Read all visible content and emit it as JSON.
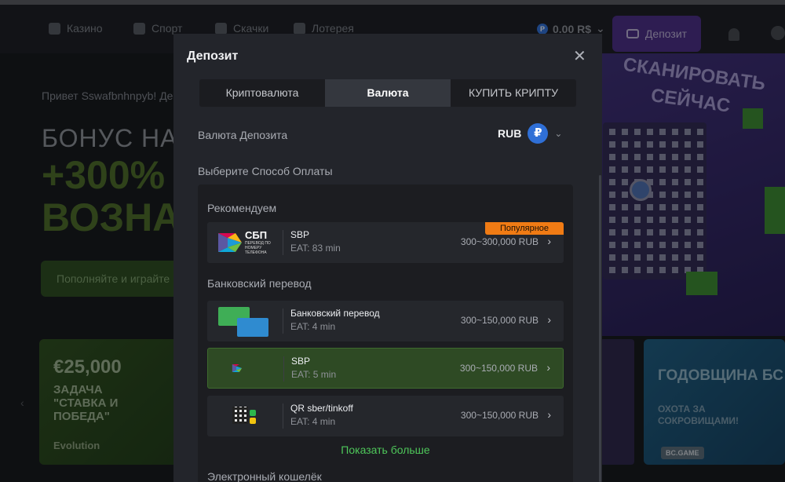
{
  "header": {
    "nav": [
      {
        "label": "Казино",
        "icon": "casino-icon"
      },
      {
        "label": "Спорт",
        "icon": "sport-icon"
      },
      {
        "label": "Скачки",
        "icon": "horse-icon"
      },
      {
        "label": "Лотерея",
        "icon": "lottery-icon"
      }
    ],
    "balance": "0.00 R$",
    "balance_icon": "P",
    "deposit_button": "Депозит"
  },
  "hero": {
    "greeting": "Привет Sswafbnhnpyb! Де",
    "bonus": "БОНУС НА",
    "line1": "+300%",
    "line2": "ВОЗНА",
    "button": "Пополняйте и играйте"
  },
  "promo": {
    "title": "СКАНИРОВАТЬ СЕЙЧАС"
  },
  "cards": {
    "left": {
      "amount": "€25,000",
      "task": "ЗАДАЧА \"СТАВКА И ПОБЕДА\"",
      "provider": "Evolution"
    },
    "right": {
      "title": "ГОДОВЩИНА БС",
      "subtitle": "ОХОТА ЗА СОКРОВИЩАМИ!",
      "brand": "BC.GAME"
    }
  },
  "modal": {
    "title": "Депозит",
    "close": "✕",
    "tabs": [
      {
        "label": "Криптовалюта",
        "active": false
      },
      {
        "label": "Валюта",
        "active": true
      },
      {
        "label": "КУПИТЬ КРИПТУ",
        "active": false
      }
    ],
    "currency_label": "Валюта Депозита",
    "currency_code": "RUB",
    "currency_symbol": "₽",
    "payment_label": "Выберите Способ Оплаты",
    "sections": {
      "recommended": "Рекомендуем",
      "bank": "Банковский перевод",
      "ewallet": "Электронный кошелёк"
    },
    "sbp_logo": {
      "name": "СБП",
      "sub": "ПЕРЕВОД ПО НОМЕРУ ТЕЛЕФОНА"
    },
    "methods": [
      {
        "name": "SBP",
        "eat": "EAT: 83 min",
        "range": "300~300,000 RUB",
        "badge": "Популярное"
      },
      {
        "name": "Банковский перевод",
        "eat": "EAT: 4 min",
        "range": "300~150,000 RUB"
      },
      {
        "name": "SBP",
        "eat": "EAT: 5 min",
        "range": "300~150,000 RUB"
      },
      {
        "name": "QR sber/tinkoff",
        "eat": "EAT: 4 min",
        "range": "300~150,000 RUB"
      }
    ],
    "show_more": "Показать больше"
  },
  "colors": {
    "accent_green": "#4ec75a",
    "badge_orange": "#f07b14",
    "deposit_purple": "#4b2c86"
  }
}
